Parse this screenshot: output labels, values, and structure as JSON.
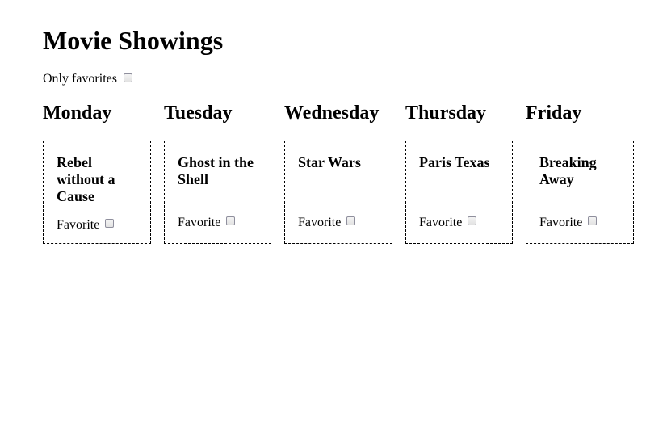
{
  "page": {
    "title": "Movie Showings"
  },
  "filter": {
    "only_favorites_label": "Only favorites",
    "only_favorites_checked": false
  },
  "days": [
    {
      "name": "Monday",
      "movie": {
        "title": "Rebel without a Cause",
        "favorite_label": "Favorite",
        "favorite_checked": false
      }
    },
    {
      "name": "Tuesday",
      "movie": {
        "title": "Ghost in the Shell",
        "favorite_label": "Favorite",
        "favorite_checked": false
      }
    },
    {
      "name": "Wednesday",
      "movie": {
        "title": "Star Wars",
        "favorite_label": "Favorite",
        "favorite_checked": false
      }
    },
    {
      "name": "Thursday",
      "movie": {
        "title": "Paris Texas",
        "favorite_label": "Favorite",
        "favorite_checked": false
      }
    },
    {
      "name": "Friday",
      "movie": {
        "title": "Breaking Away",
        "favorite_label": "Favorite",
        "favorite_checked": false
      }
    }
  ]
}
